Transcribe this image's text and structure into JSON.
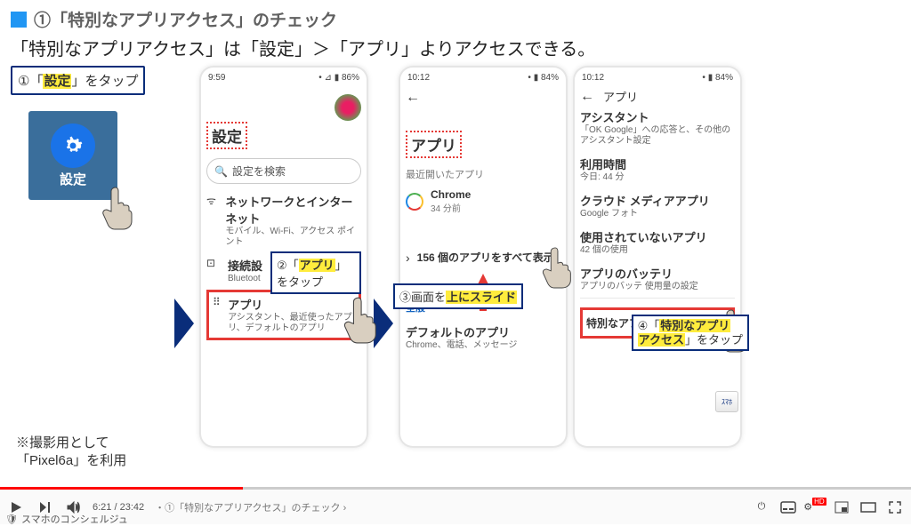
{
  "title": "①「特別なアプリアクセス」のチェック",
  "subtitle": "「特別なアプリアクセス」は「設定」＞「アプリ」よりアクセスできる。",
  "footnote": "※撮影用として\n「Pixel6a」を利用",
  "callouts": {
    "c1_pre": "①「",
    "c1_hl": "設定",
    "c1_post": "」をタップ",
    "c2_pre": "②「",
    "c2_hl": "アプリ",
    "c2_post": "」をタップ",
    "c3_pre": "③画面を",
    "c3_hl": "上にスライド",
    "c4_pre": "④「",
    "c4_hl1": "特別なアプリ",
    "c4_hl2": "アクセス",
    "c4_post": "」をタップ"
  },
  "settings_tile_label": "設定",
  "phone1": {
    "time": "9:59",
    "battery": "86%",
    "header": "設定",
    "search_placeholder": "設定を検索",
    "network_title": "ネットワークとインターネット",
    "network_sub": "モバイル、Wi-Fi、アクセス ポイント",
    "conn_title": "接続設",
    "conn_sub": "Bluetoot",
    "app_title": "アプリ",
    "app_sub": "アシスタント、最近使ったアプリ、デフォルトのアプリ"
  },
  "phone2": {
    "time": "10:12",
    "battery": "84%",
    "header": "アプリ",
    "recent_label": "最近開いたアプリ",
    "chrome": "Chrome",
    "chrome_sub": "34 分前",
    "showall": "156 個のアプリをすべて表示",
    "general": "全般",
    "default_title": "デフォルトのアプリ",
    "default_sub": "Chrome、電話、メッセージ"
  },
  "phone3": {
    "time": "10:12",
    "battery": "84%",
    "back_title": "アプリ",
    "assistant": "アシスタント",
    "assistant_sub": "「OK Google」への応答と、その他のアシスタント設定",
    "usage": "利用時間",
    "usage_sub": "今日: 44 分",
    "cloud": "クラウド メディアアプリ",
    "cloud_sub": "Google フォト",
    "unused": "使用されていないアプリ",
    "unused_sub": "42 個の使用",
    "battery_t": "アプリのバッテリ",
    "battery_sub": "アプリのバッテ   使用量の設定",
    "special": "特別なアプリアクセス"
  },
  "youtube": {
    "time": "6:21 / 23:42",
    "chapter": "・①「特別なアプリアクセス」のチェック",
    "channel": "スマホのコンシェルジュ"
  }
}
